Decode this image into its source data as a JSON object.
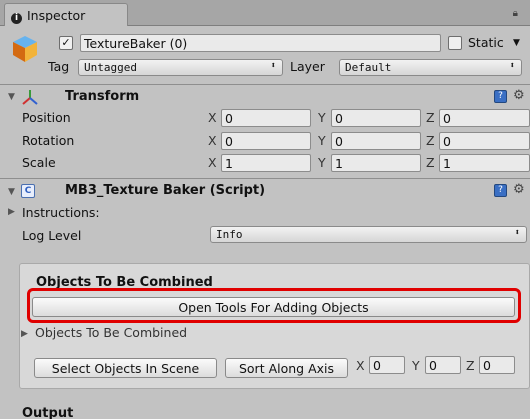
{
  "tab": {
    "label": "Inspector"
  },
  "object": {
    "name": "TextureBaker (0)",
    "static_label": "Static",
    "tag_label": "Tag",
    "tag_value": "Untagged",
    "layer_label": "Layer",
    "layer_value": "Default"
  },
  "transform": {
    "title": "Transform",
    "rows": [
      {
        "label": "Position",
        "x": "0",
        "y": "0",
        "z": "0"
      },
      {
        "label": "Rotation",
        "x": "0",
        "y": "0",
        "z": "0"
      },
      {
        "label": "Scale",
        "x": "1",
        "y": "1",
        "z": "1"
      }
    ]
  },
  "axes": {
    "x": "X",
    "y": "Y",
    "z": "Z"
  },
  "script": {
    "title": "MB3_Texture Baker (Script)",
    "instructions_label": "Instructions:",
    "log_level_label": "Log Level",
    "log_level_value": "Info"
  },
  "objects": {
    "section_title": "Objects To Be Combined",
    "open_tools_button": "Open Tools For Adding Objects",
    "list_label": "Objects To Be Combined",
    "select_button": "Select Objects In Scene",
    "sort_button": "Sort Along Axis",
    "sort_x": "0",
    "sort_y": "0",
    "sort_z": "0"
  },
  "output": {
    "title": "Output"
  },
  "colors": {
    "highlight": "#e00000",
    "panel_bg": "#c2c2c2"
  }
}
